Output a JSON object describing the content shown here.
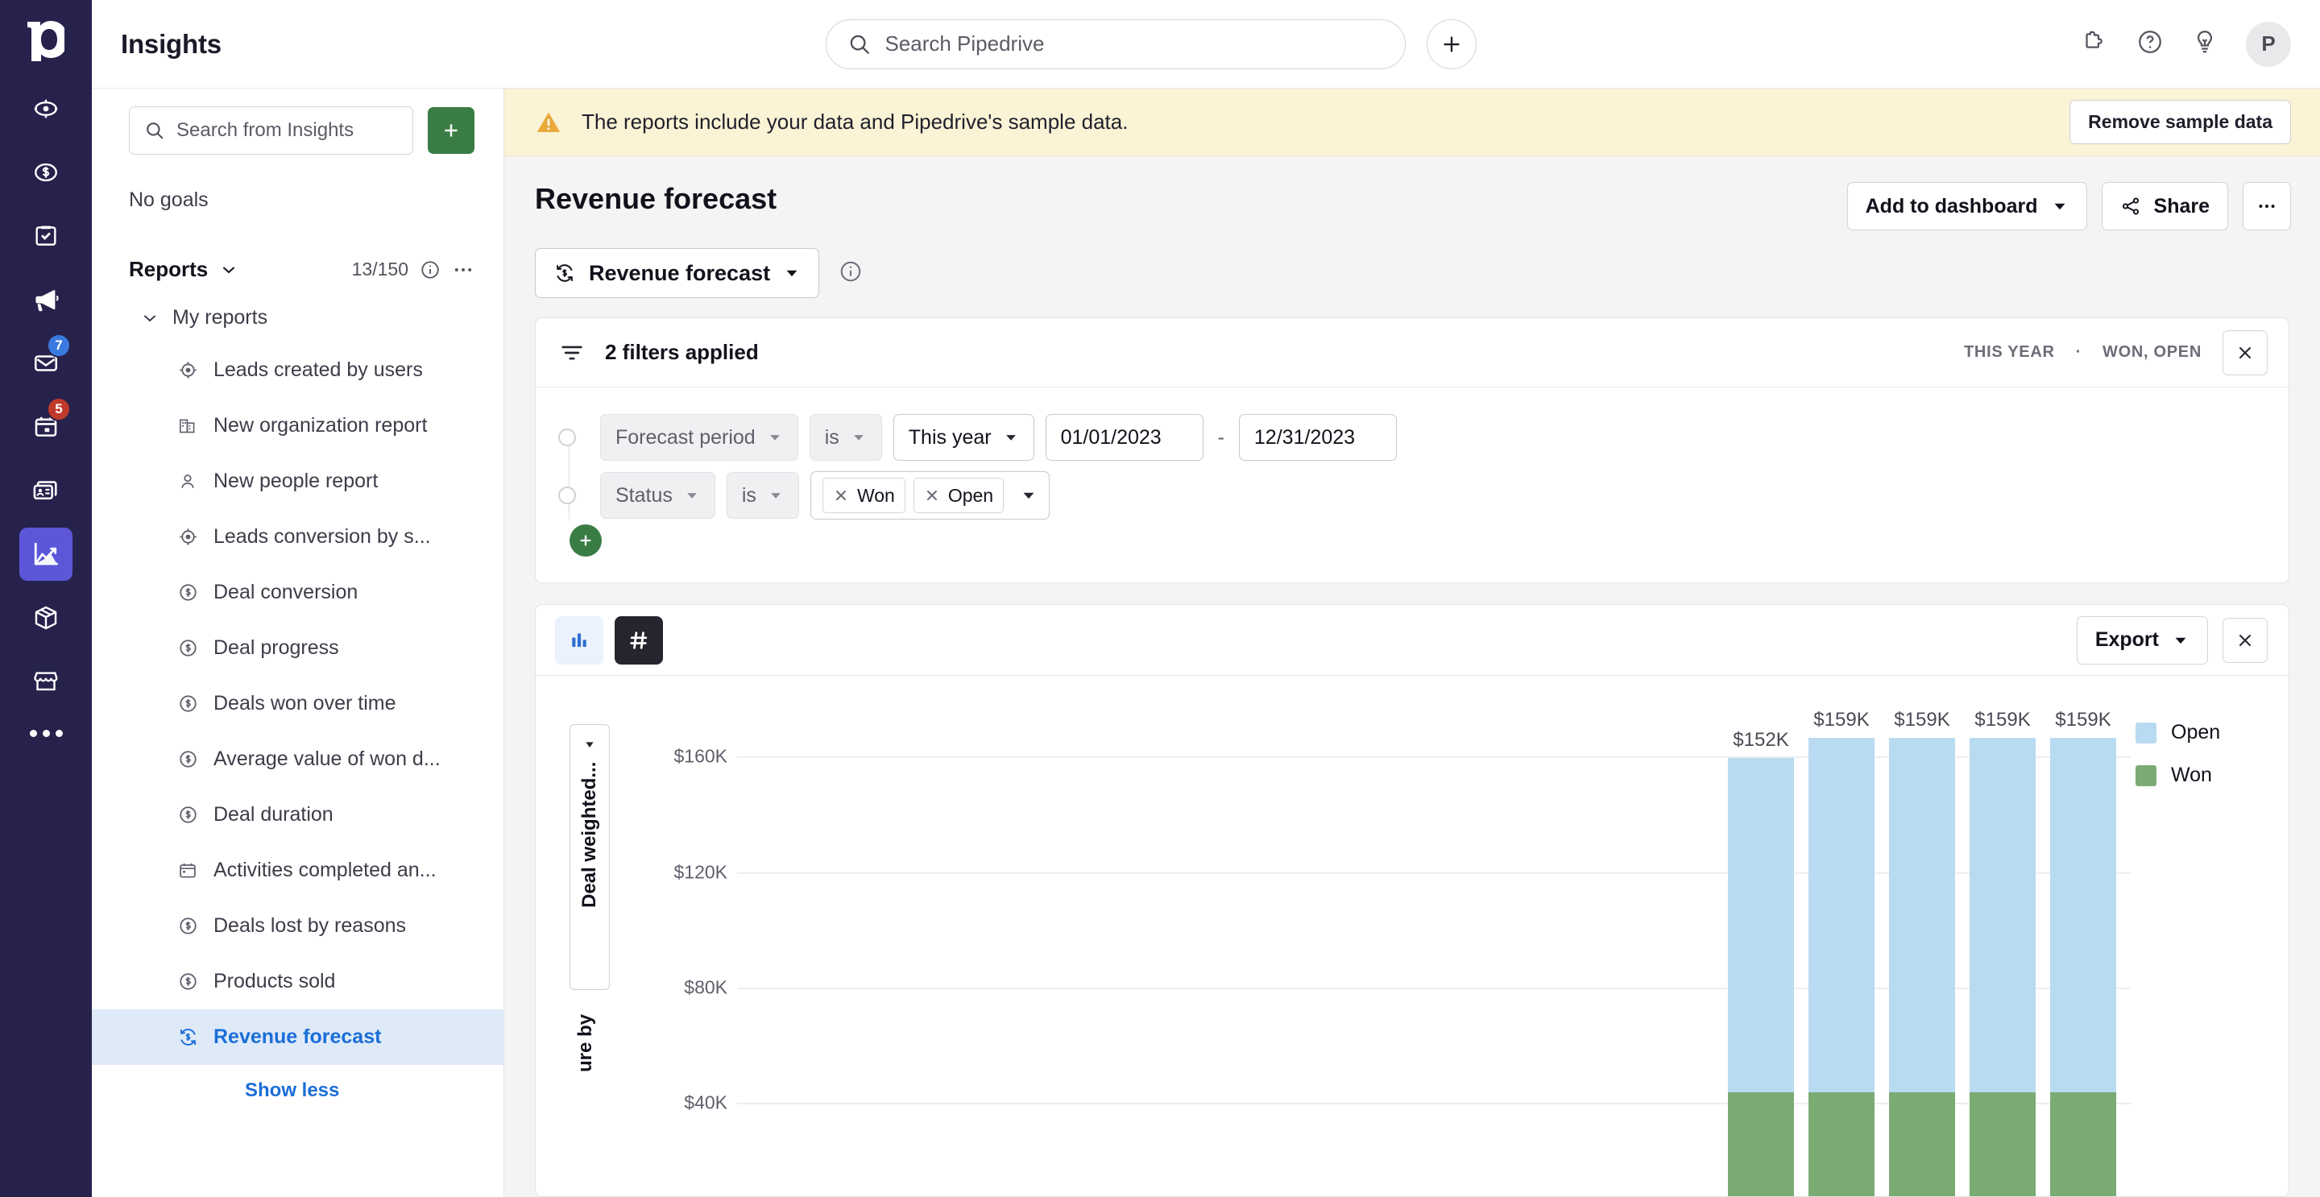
{
  "rail": {
    "logo": "pipedrive-logo",
    "items": [
      {
        "name": "leads-icon",
        "badge": null,
        "active": false
      },
      {
        "name": "deals-icon",
        "badge": null,
        "active": false
      },
      {
        "name": "activities-icon",
        "badge": null,
        "active": false
      },
      {
        "name": "campaigns-icon",
        "badge": null,
        "active": false
      },
      {
        "name": "mail-icon",
        "badge": "7",
        "badge_color": "blue",
        "active": false
      },
      {
        "name": "calendar-icon",
        "badge": "5",
        "badge_color": "red",
        "active": false
      },
      {
        "name": "contacts-icon",
        "badge": null,
        "active": false
      },
      {
        "name": "insights-icon",
        "badge": null,
        "active": true
      },
      {
        "name": "products-icon",
        "badge": null,
        "active": false
      },
      {
        "name": "marketplace-icon",
        "badge": null,
        "active": false
      }
    ],
    "more": "more-icon"
  },
  "topbar": {
    "app_title": "Insights",
    "search_placeholder": "Search Pipedrive",
    "add_button": "+",
    "icons": [
      "puzzle-icon",
      "help-icon",
      "lightbulb-icon"
    ],
    "avatar_initial": "P"
  },
  "panel": {
    "search_placeholder": "Search from Insights",
    "add_label": "+",
    "no_goals": "No goals",
    "reports_label": "Reports",
    "reports_count": "13/150",
    "my_reports": "My reports",
    "items": [
      {
        "label": "Leads created by users",
        "icon": "target-icon",
        "selected": false
      },
      {
        "label": "New organization report",
        "icon": "organization-icon",
        "selected": false
      },
      {
        "label": "New people report",
        "icon": "person-icon",
        "selected": false
      },
      {
        "label": "Leads conversion by s...",
        "icon": "target-icon",
        "selected": false
      },
      {
        "label": "Deal conversion",
        "icon": "deal-icon",
        "selected": false
      },
      {
        "label": "Deal progress",
        "icon": "deal-icon",
        "selected": false
      },
      {
        "label": "Deals won over time",
        "icon": "deal-icon",
        "selected": false
      },
      {
        "label": "Average value of won d...",
        "icon": "deal-icon",
        "selected": false
      },
      {
        "label": "Deal duration",
        "icon": "deal-icon",
        "selected": false
      },
      {
        "label": "Activities completed an...",
        "icon": "calendar-icon",
        "selected": false
      },
      {
        "label": "Deals lost by reasons",
        "icon": "deal-icon",
        "selected": false
      },
      {
        "label": "Products sold",
        "icon": "deal-icon",
        "selected": false
      },
      {
        "label": "Revenue forecast",
        "icon": "forecast-icon",
        "selected": true
      }
    ],
    "show_less": "Show less"
  },
  "banner": {
    "text": "The reports include your data and Pipedrive's sample data.",
    "button": "Remove sample data"
  },
  "report": {
    "title": "Revenue forecast",
    "type_select": "Revenue forecast",
    "add_to_dashboard": "Add to dashboard",
    "share": "Share",
    "more": "•••"
  },
  "filters": {
    "header": "2 filters applied",
    "meta_period": "THIS YEAR",
    "meta_sep": "·",
    "meta_status": "WON, OPEN",
    "rows": [
      {
        "field": "Forecast period",
        "operator": "is",
        "value": "This year",
        "date_from": "01/01/2023",
        "date_to": "12/31/2023",
        "dash": "-"
      },
      {
        "field": "Status",
        "operator": "is",
        "tags": [
          "Won",
          "Open"
        ]
      }
    ],
    "add_filter": "+"
  },
  "chart_panel": {
    "export_label": "Export",
    "view_chart": "bar-chart-icon",
    "view_numbers": "number-icon"
  },
  "chart_data": {
    "type": "bar",
    "stacked": true,
    "title": "",
    "ylabel": "Deal weighted... ure by",
    "ylabel_top": "Deal weighted...",
    "ylabel_bottom": "ure by",
    "xlabel": "",
    "ytick_labels": [
      "$160K",
      "$120K",
      "$80K",
      "$40K"
    ],
    "ytick_values": [
      160000,
      120000,
      80000,
      40000
    ],
    "ylim": [
      0,
      176000
    ],
    "grid": true,
    "legend_position": "right",
    "legend": [
      {
        "name": "Open",
        "color": "#b9dbf2"
      },
      {
        "name": "Won",
        "color": "#7aab73"
      }
    ],
    "categories": [
      "",
      "",
      "",
      "",
      ""
    ],
    "data_labels": [
      "$152K",
      "$159K",
      "$159K",
      "$159K",
      "$159K"
    ],
    "totals": [
      152000,
      159000,
      159000,
      159000,
      159000
    ],
    "series": [
      {
        "name": "Open",
        "color": "#b9dbf2",
        "values": [
          116000,
          123000,
          123000,
          123000,
          123000
        ]
      },
      {
        "name": "Won",
        "color": "#7aab73",
        "values": [
          36000,
          36000,
          36000,
          36000,
          36000
        ]
      }
    ]
  }
}
